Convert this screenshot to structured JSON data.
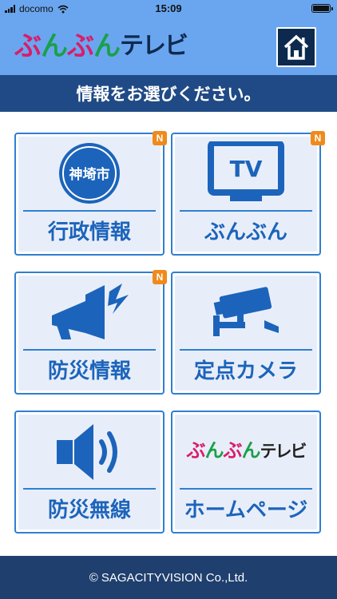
{
  "status_bar": {
    "carrier": "docomo",
    "time": "15:09"
  },
  "header": {
    "logo_kana": [
      "ぶ",
      "ん",
      "ぶ",
      "ん"
    ],
    "logo_tv": "テレビ"
  },
  "title_band": {
    "text": "情報をお選びください。"
  },
  "tiles": [
    {
      "label": "行政情報",
      "icon_text": "神埼市",
      "icon": "city-emblem-icon",
      "badge": "N"
    },
    {
      "label": "ぶんぶん",
      "icon_text": "TV",
      "icon": "tv-icon",
      "badge": "N"
    },
    {
      "label": "防災情報",
      "icon": "megaphone-icon",
      "badge": "N"
    },
    {
      "label": "定点カメラ",
      "icon": "security-camera-icon"
    },
    {
      "label": "防災無線",
      "icon": "speaker-icon"
    },
    {
      "label": "ホームページ",
      "icon": "bunbun-tv-logo",
      "logo_tv": "テレビ"
    }
  ],
  "footer": {
    "text": "© SAGACITYVISION Co.,Ltd."
  },
  "colors": {
    "header_bg": "#6aa6f0",
    "title_band_bg": "#1f4a85",
    "tile_border": "#2f7fd2",
    "tile_bg": "#e8eef9",
    "tile_label": "#1c64bb",
    "badge": "#f08a1c",
    "footer_bg": "#1f3f6e",
    "logo_pink": "#d81e6a",
    "logo_green": "#1aa04a"
  }
}
